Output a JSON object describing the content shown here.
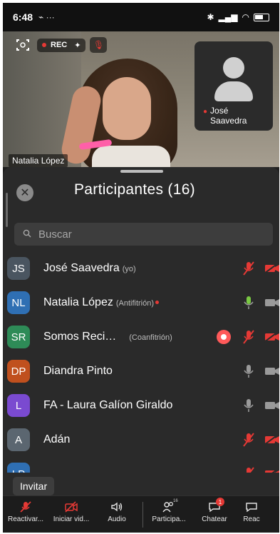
{
  "status_bar": {
    "time": "6:48",
    "extra": "⌁ ···"
  },
  "video": {
    "rec_label": "REC",
    "main_speaker_name": "Natalia López",
    "self_tile_name": "José Saavedra"
  },
  "sheet": {
    "title": "Participantes (16)",
    "search_placeholder": "Buscar",
    "invite_label": "Invitar"
  },
  "participants": [
    {
      "initials": "JS",
      "name": "José Saavedra",
      "role": "(yo)",
      "color": "#4a5560",
      "mic": "muted",
      "cam": "off"
    },
    {
      "initials": "NL",
      "name": "Natalia López",
      "role": "(Antifitrión)",
      "color": "#2f6fb3",
      "mic": "active",
      "cam": "on"
    },
    {
      "initials": "SR",
      "name": "Somos Reci…",
      "role": "(Coanfitrión)",
      "color": "#2e8b57",
      "mic": "muted",
      "cam": "off"
    },
    {
      "initials": "DP",
      "name": "Diandra Pinto",
      "role": "",
      "color": "#c0501e",
      "mic": "on",
      "cam": "on"
    },
    {
      "initials": "L",
      "name": "FA - Laura Galíon Giraldo",
      "role": "",
      "color": "#7a4ad0",
      "mic": "on",
      "cam": "on"
    },
    {
      "initials": "A",
      "name": "Adán",
      "role": "",
      "color": "#5b6670",
      "mic": "muted",
      "cam": "off"
    },
    {
      "initials": "LP",
      "name": "",
      "role": "",
      "color": "#2f6fb3",
      "mic": "muted",
      "cam": "off"
    }
  ],
  "toolbar": {
    "unmute": "Reactivar...",
    "start_video": "Iniciar vid...",
    "audio": "Audio",
    "participants": "Participa...",
    "participants_count": "16",
    "chat": "Chatear",
    "chat_badge": "1",
    "react": "Reac"
  },
  "colors": {
    "accent_red": "#e53935",
    "mic_green": "#7ac943",
    "sheet_bg": "#2a2a2a"
  }
}
